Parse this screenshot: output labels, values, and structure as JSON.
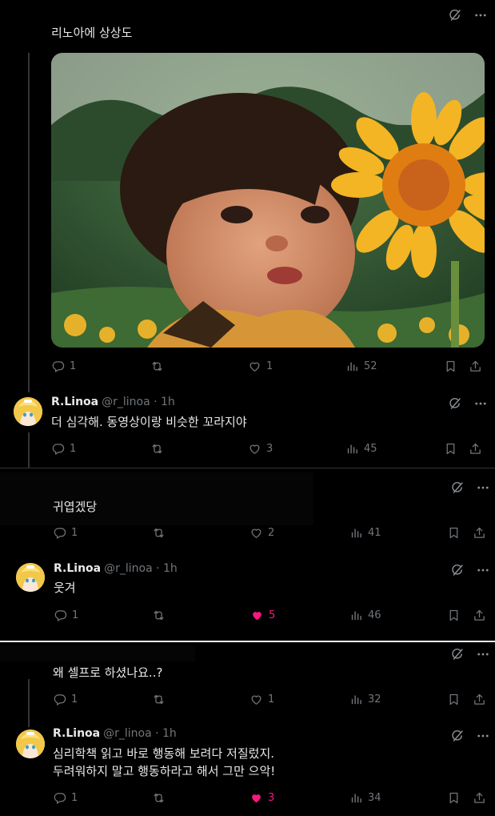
{
  "posts": [
    {
      "text": "리노아에 상상도",
      "replies": "1",
      "reposts": "",
      "likes": "1",
      "views": "52",
      "liked": false
    },
    {
      "name": "R.Linoa",
      "handle": "@r_linoa · 1h",
      "text": "더 심각해. 동영상이랑 비슷한 꼬라지야",
      "replies": "1",
      "reposts": "",
      "likes": "3",
      "views": "45",
      "liked": false
    },
    {
      "text": "귀엽겠당",
      "replies": "1",
      "reposts": "",
      "likes": "2",
      "views": "41",
      "liked": false
    },
    {
      "name": "R.Linoa",
      "handle": "@r_linoa · 1h",
      "text": "웃겨",
      "replies": "1",
      "reposts": "",
      "likes": "5",
      "views": "46",
      "liked": true
    },
    {
      "text": "왜 셀프로 하셨나요..?",
      "replies": "1",
      "reposts": "",
      "likes": "1",
      "views": "32",
      "liked": false
    },
    {
      "name": "R.Linoa",
      "handle": "@r_linoa · 1h",
      "text": "심리학책 읽고 바로 행동해 보려다 저질렀지.\n두려워하지 말고 행동하라고 해서 그만 으악!",
      "replies": "1",
      "reposts": "",
      "likes": "3",
      "views": "34",
      "liked": true
    }
  ],
  "icons": {
    "reply": "reply-icon",
    "repost": "repost-icon",
    "like": "heart-icon",
    "views": "views-icon",
    "bookmark": "bookmark-icon",
    "share": "share-icon",
    "grok": "grok-icon",
    "more": "more-icon"
  },
  "colors": {
    "background": "#000000",
    "text": "#e7e9ea",
    "muted": "#71767b",
    "like": "#f91880",
    "divider": "#2f3336"
  }
}
